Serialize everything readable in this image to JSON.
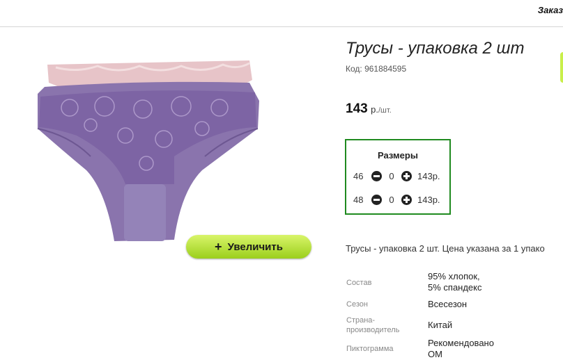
{
  "header": {
    "order_link": "Заказ"
  },
  "product": {
    "title": "Трусы - упаковка 2 шт",
    "code": "Код: 961884595",
    "price": {
      "value": "143",
      "currency": "р.",
      "unit": "/шт."
    },
    "zoom_button": "Увеличить",
    "description": "Трусы - упаковка 2 шт. Цена указана за 1 упако"
  },
  "sizes": {
    "title": "Размеры",
    "rows": [
      {
        "size": "46",
        "qty": "0",
        "price": "143р."
      },
      {
        "size": "48",
        "qty": "0",
        "price": "143р."
      }
    ]
  },
  "specs": [
    {
      "label": "Состав",
      "value_line1": "95% хлопок,",
      "value_line2": "5% спандекс"
    },
    {
      "label": "Сезон",
      "value_line1": "Всесезон"
    },
    {
      "label_line1": "Страна-",
      "label_line2": "производитель",
      "value_line1": "Китай"
    },
    {
      "label": "Пиктограмма",
      "value_line1": "Рекомендовано",
      "value_line2": "OM"
    }
  ],
  "colors": {
    "border_green": "#1f8a1f",
    "button_light": "#d9f56a",
    "button_dark": "#9bcf1c",
    "product_purple": "#8a74ad",
    "product_pink": "#e7c4c8"
  },
  "icons": {
    "zoom": "plus-icon",
    "decrement": "minus-circle-icon",
    "increment": "plus-circle-icon"
  }
}
